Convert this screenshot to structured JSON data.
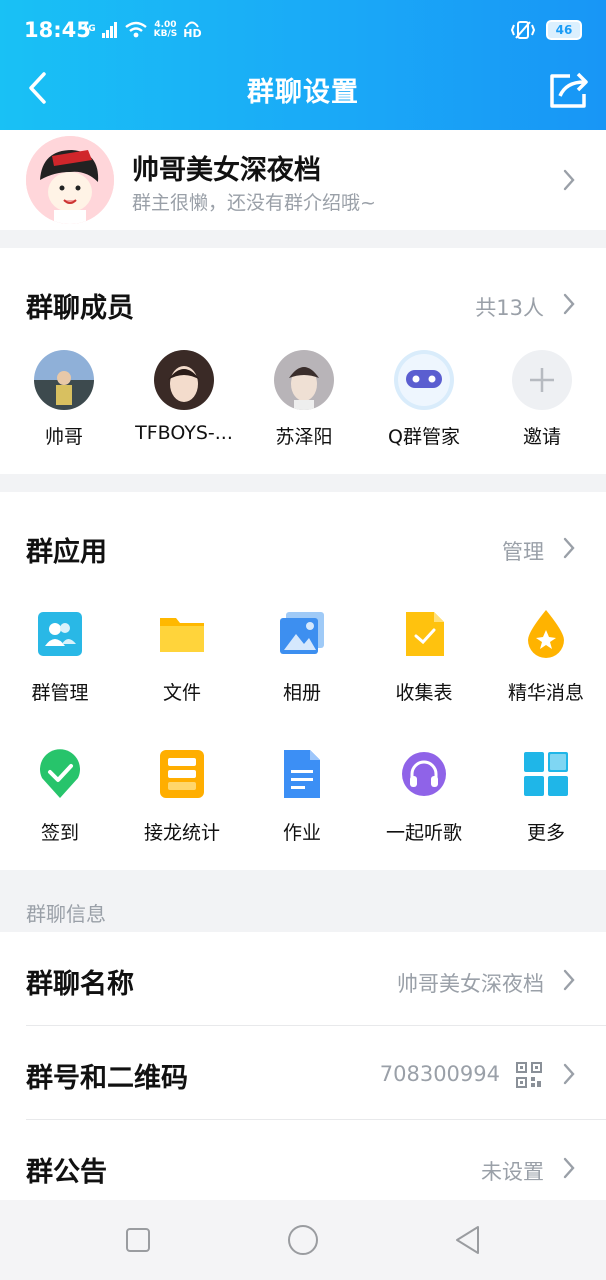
{
  "status": {
    "time": "18:45",
    "network": "4G",
    "speed_value": "4.00",
    "speed_unit": "KB/S",
    "hd": "HD",
    "battery": "46"
  },
  "nav": {
    "title": "群聊设置"
  },
  "profile": {
    "name": "帅哥美女深夜档",
    "intro": "群主很懒，还没有群介绍哦~"
  },
  "members": {
    "title": "群聊成员",
    "count": "共13人",
    "list": [
      {
        "name": "帅哥"
      },
      {
        "name": "TFBOYS-..."
      },
      {
        "name": "苏泽阳"
      },
      {
        "name": "Q群管家"
      },
      {
        "name": "邀请"
      }
    ]
  },
  "apps": {
    "title": "群应用",
    "manage": "管理",
    "items": [
      {
        "name": "群管理"
      },
      {
        "name": "文件"
      },
      {
        "name": "相册"
      },
      {
        "name": "收集表"
      },
      {
        "name": "精华消息"
      },
      {
        "name": "签到"
      },
      {
        "name": "接龙统计"
      },
      {
        "name": "作业"
      },
      {
        "name": "一起听歌"
      },
      {
        "name": "更多"
      }
    ]
  },
  "info": {
    "section_label": "群聊信息",
    "rows": [
      {
        "key": "群聊名称",
        "value": "帅哥美女深夜档"
      },
      {
        "key": "群号和二维码",
        "value": "708300994"
      },
      {
        "key": "群公告",
        "value": "未设置"
      }
    ]
  },
  "colors": {
    "header_start": "#19c1f5",
    "header_end": "#1896f6",
    "secondary_text": "#9aa0a8"
  }
}
